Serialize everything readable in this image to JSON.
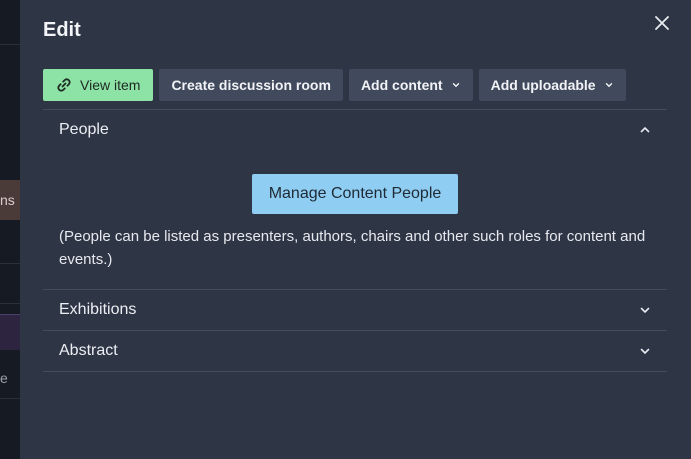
{
  "background_fragments": {
    "frag1": "ns",
    "frag2": "e"
  },
  "drawer": {
    "title": "Edit",
    "close_icon": "close-icon"
  },
  "toolbar": {
    "view_item": "View item",
    "view_item_icon": "link-icon",
    "create_discussion": "Create discussion room",
    "add_content": "Add content",
    "add_uploadable": "Add uploadable"
  },
  "sections": {
    "people": {
      "label": "People",
      "expanded": true,
      "manage_button": "Manage Content People",
      "note": "(People can be listed as presenters, authors, chairs and other such roles for content and events.)"
    },
    "exhibitions": {
      "label": "Exhibitions",
      "expanded": false
    },
    "abstract": {
      "label": "Abstract",
      "expanded": false
    }
  },
  "colors": {
    "drawer_bg": "#2e3545",
    "view_button": "#8de3a6",
    "manage_button": "#8fcdf2",
    "toolbar_button": "#414a5c"
  }
}
